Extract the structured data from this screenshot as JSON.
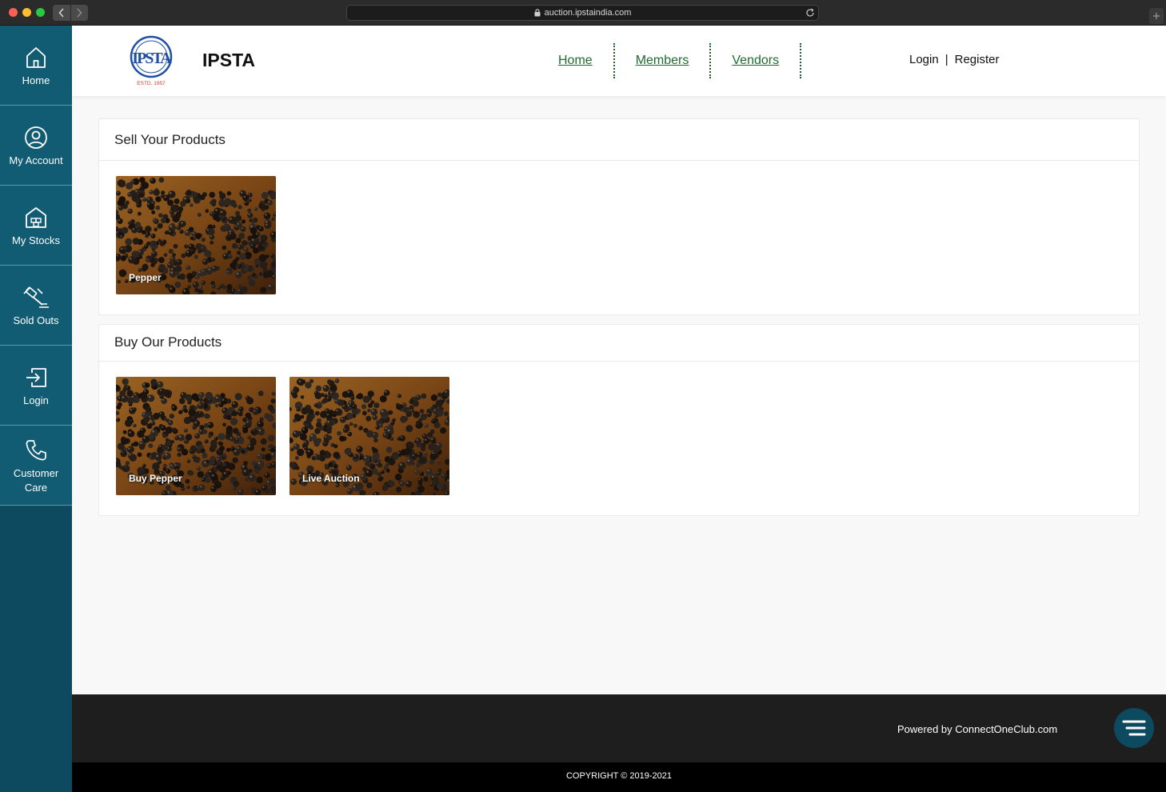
{
  "browser": {
    "url": "auction.ipstaindia.com"
  },
  "sidebar": {
    "items": [
      {
        "label": "Home",
        "icon": "home-icon"
      },
      {
        "label": "My Account",
        "icon": "user-circle-icon"
      },
      {
        "label": "My Stocks",
        "icon": "warehouse-icon"
      },
      {
        "label": "Sold Outs",
        "icon": "auction-hammer-icon"
      },
      {
        "label": "Login",
        "icon": "login-icon"
      },
      {
        "label": "Customer Care",
        "icon": "phone-icon"
      }
    ]
  },
  "header": {
    "logo_text": "IPSTA",
    "logo_estd": "ESTD. 1957",
    "brand": "IPSTA",
    "nav": [
      "Home",
      "Members",
      "Vendors"
    ],
    "login": "Login",
    "separator": "|",
    "register": "Register"
  },
  "sell": {
    "title": "Sell Your Products",
    "tiles": [
      {
        "label": "Pepper"
      }
    ]
  },
  "buy": {
    "title": "Buy Our Products",
    "tiles": [
      {
        "label": "Buy Pepper"
      },
      {
        "label": "Live Auction"
      }
    ]
  },
  "footer": {
    "powered": "Powered by ConnectOneClub.com",
    "copyright": "COPYRIGHT © 2019-2021"
  },
  "colors": {
    "sidebar_bg": "#0d4a5f",
    "sidebar_item": "#115b73",
    "nav_link": "#1f6b2f",
    "footer_bg": "#1e1e1e"
  }
}
